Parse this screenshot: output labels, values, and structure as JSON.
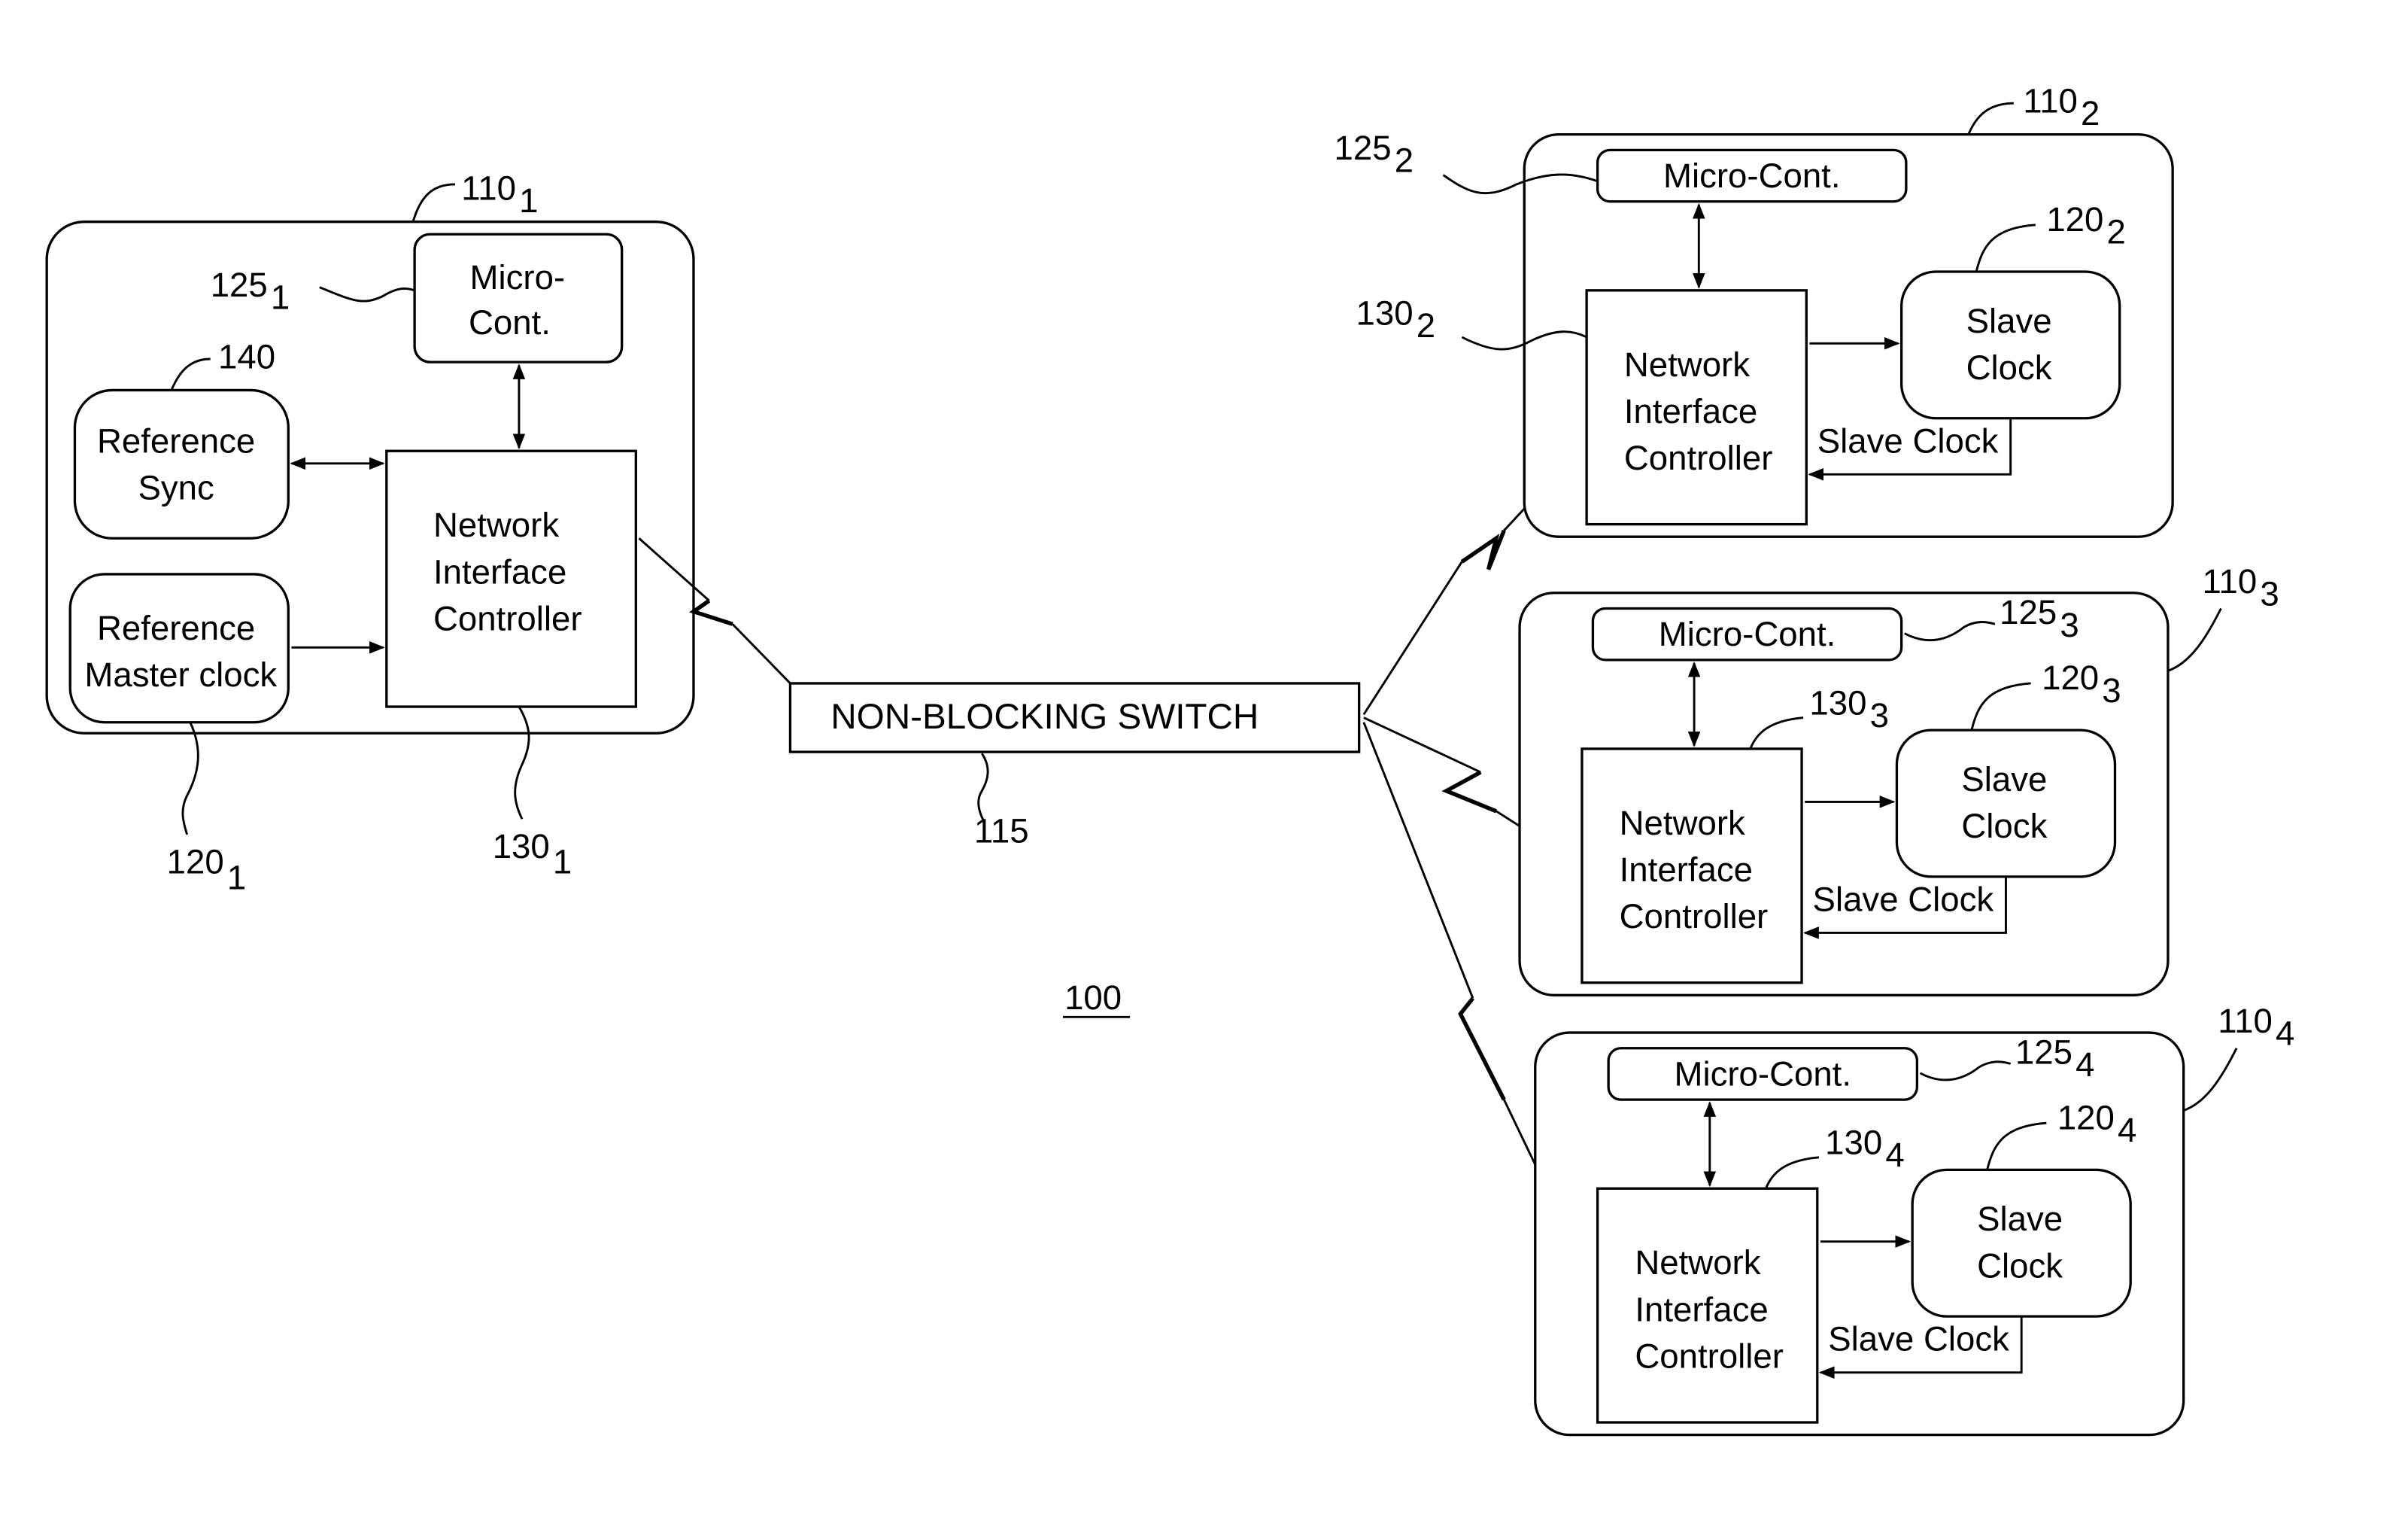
{
  "figure": {
    "ref": "100"
  },
  "switch": {
    "label": "NON-BLOCKING SWITCH",
    "ref": "115"
  },
  "master_node": {
    "ref": "110",
    "sub": "1",
    "micro": {
      "line1": "Micro-",
      "line2": "Cont.",
      "ref": "125",
      "sub": "1"
    },
    "sync": {
      "line1": "Reference",
      "line2": "Sync",
      "ref": "140"
    },
    "master_clock": {
      "line1": "Reference",
      "line2": "Master clock",
      "ref": "120",
      "sub": "1"
    },
    "nic": {
      "line1": "Network",
      "line2": "Interface",
      "line3": "Controller",
      "ref": "130",
      "sub": "1"
    }
  },
  "slave_nodes": [
    {
      "ref": "110",
      "sub": "2",
      "micro": "Micro-Cont.",
      "micro_ref": "125",
      "slave_ref": "120",
      "nic_ref": "130",
      "nic": [
        "Network",
        "Interface",
        "Controller"
      ],
      "slave": [
        "Slave",
        "Clock"
      ],
      "feedback": "Slave Clock"
    },
    {
      "ref": "110",
      "sub": "3",
      "micro": "Micro-Cont.",
      "micro_ref": "125",
      "slave_ref": "120",
      "nic_ref": "130",
      "nic": [
        "Network",
        "Interface",
        "Controller"
      ],
      "slave": [
        "Slave",
        "Clock"
      ],
      "feedback": "Slave Clock"
    },
    {
      "ref": "110",
      "sub": "4",
      "micro": "Micro-Cont.",
      "micro_ref": "125",
      "slave_ref": "120",
      "nic_ref": "130",
      "nic": [
        "Network",
        "Interface",
        "Controller"
      ],
      "slave": [
        "Slave",
        "Clock"
      ],
      "feedback": "Slave Clock"
    }
  ]
}
